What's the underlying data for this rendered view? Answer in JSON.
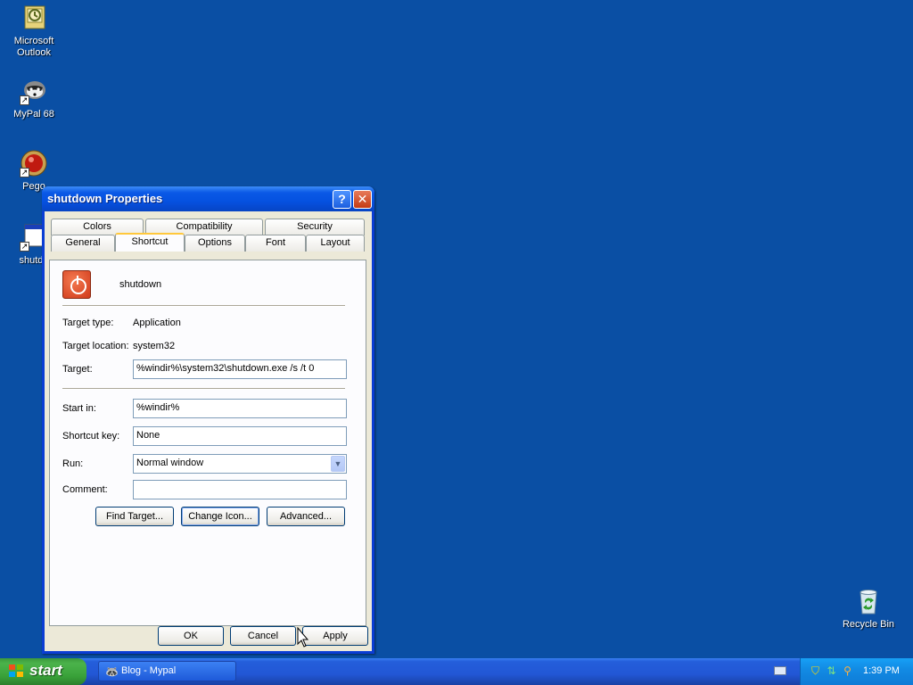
{
  "desktop": {
    "icons": [
      {
        "label_line1": "Microsoft",
        "label_line2": "Outlook"
      },
      {
        "label_line1": "MyPal 68",
        "label_line2": ""
      },
      {
        "label_line1": "Pego",
        "label_line2": ""
      },
      {
        "label_line1": "shutdo",
        "label_line2": ""
      },
      {
        "label_line1": "Recycle Bin",
        "label_line2": ""
      }
    ]
  },
  "dialog": {
    "title": "shutdown Properties",
    "help_glyph": "?",
    "close_glyph": "✕",
    "tabs_row1": [
      "Colors",
      "Compatibility",
      "Security"
    ],
    "tabs_row2": [
      "General",
      "Shortcut",
      "Options",
      "Font",
      "Layout"
    ],
    "active_tab": "Shortcut",
    "shortcut_name": "shutdown",
    "target_type_label": "Target type:",
    "target_type_value": "Application",
    "target_location_label": "Target location:",
    "target_location_value": "system32",
    "target_label": "Target:",
    "target_value": "%windir%\\system32\\shutdown.exe /s /t 0",
    "start_in_label": "Start in:",
    "start_in_value": "%windir%",
    "shortcut_key_label": "Shortcut key:",
    "shortcut_key_value": "None",
    "run_label": "Run:",
    "run_value": "Normal window",
    "comment_label": "Comment:",
    "comment_value": "",
    "find_target_label": "Find Target...",
    "change_icon_label": "Change Icon...",
    "advanced_label": "Advanced...",
    "ok_label": "OK",
    "cancel_label": "Cancel",
    "apply_label": "Apply"
  },
  "taskbar": {
    "start_label": "start",
    "task_label": "Blog - Mypal",
    "clock": "1:39 PM"
  },
  "colors": {
    "desktop": "#0a4fa4",
    "title_bar": "#0551e0",
    "dialog_face": "#ece9d8",
    "active_tab_accent": "#ffc83c",
    "start_button": "#3c9a3c"
  }
}
